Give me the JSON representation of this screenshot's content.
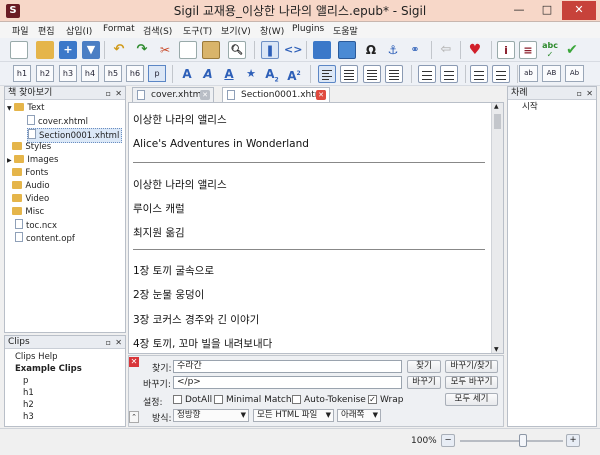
{
  "window": {
    "title": "Sigil 교재용_이상한 나라의 앨리스.epub* - Sigil",
    "app_icon_letter": "S",
    "minimize": "—",
    "maximize": "□",
    "close": "✕"
  },
  "menu": [
    "파일",
    "편집",
    "삽입(I)",
    "Format",
    "검색(S)",
    "도구(T)",
    "보기(V)",
    "창(W)",
    "Plugins",
    "도움말"
  ],
  "toolbar2": {
    "headings": [
      "h1",
      "h2",
      "h3",
      "h4",
      "h5",
      "h6",
      "p"
    ],
    "small_caps": [
      "ab",
      "AB",
      "Ab"
    ]
  },
  "book_browser": {
    "title": "책 찾아보기",
    "items": [
      "Text",
      "cover.xhtml",
      "Section0001.xhtml",
      "Styles",
      "Images",
      "Fonts",
      "Audio",
      "Video",
      "Misc",
      "toc.ncx",
      "content.opf"
    ]
  },
  "clips": {
    "title": "Clips",
    "items": [
      "Clips Help",
      "Example Clips",
      "p",
      "h1",
      "h2",
      "h3"
    ]
  },
  "tabs": [
    {
      "label": "cover.xhtml"
    },
    {
      "label": "Section0001.xhtml"
    }
  ],
  "editor": {
    "lines": [
      "이상한 나라의 앨리스",
      "Alice's Adventures in Wonderland",
      "이상한 나라의 앨리스",
      "루이스 캐럴",
      "최지원 옮김",
      "1장 토끼 굴속으로",
      "2장 눈물 웅덩이",
      "3장 코커스 경주와 긴 이야기",
      "4장 토끼, 꼬마 빌을 내려보내다"
    ]
  },
  "find": {
    "find_label": "찾기:",
    "find_value": "수라간",
    "replace_label": "바꾸기:",
    "replace_value": "</p>",
    "find_btn": "찾기",
    "replace_find_btn": "바꾸기/찾기",
    "replace_btn": "바꾸기",
    "replace_all_btn": "모두 바꾸기",
    "count_btn": "모두 세기",
    "settings_label": "설정:",
    "dotall": "DotAll",
    "minimal": "Minimal Match",
    "autotok": "Auto-Tokenise",
    "wrap": "Wrap",
    "mode_label": "방식:",
    "mode_value": "정방향",
    "scope_value": "모든 HTML 파일",
    "direction_value": "아래쪽"
  },
  "toc": {
    "title": "차례",
    "items": [
      "시작"
    ]
  },
  "status": {
    "zoom": "100%",
    "zoom_level": 0.62,
    "minus": "−",
    "plus": "+"
  },
  "colors": {
    "titlebar": "#f7d7c8",
    "close": "#c7423a",
    "accent": "#2d5fb8"
  }
}
